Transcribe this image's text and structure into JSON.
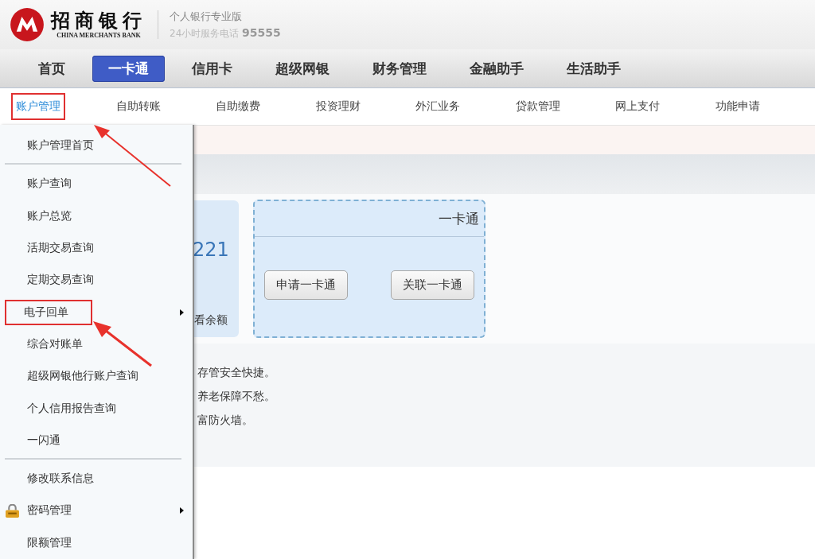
{
  "header": {
    "bank_name": "招商银行",
    "bank_name_en": "CHINA MERCHANTS BANK",
    "edition": "个人银行专业版",
    "hotline": "24小时服务电话 **95555**"
  },
  "main_nav": [
    {
      "label": "首页",
      "selected": false
    },
    {
      "label": "一卡通",
      "selected": true
    },
    {
      "label": "信用卡",
      "selected": false
    },
    {
      "label": "超级网银",
      "selected": false
    },
    {
      "label": "财务管理",
      "selected": false
    },
    {
      "label": "金融助手",
      "selected": false
    },
    {
      "label": "生活助手",
      "selected": false
    }
  ],
  "sub_nav": [
    {
      "label": "账户管理",
      "selected": true,
      "annotated": true
    },
    {
      "label": "自助转账",
      "selected": false,
      "annotated": false
    },
    {
      "label": "自助缴费",
      "selected": false,
      "annotated": false
    },
    {
      "label": "投资理财",
      "selected": false,
      "annotated": false
    },
    {
      "label": "外汇业务",
      "selected": false,
      "annotated": false
    },
    {
      "label": "贷款管理",
      "selected": false,
      "annotated": false
    },
    {
      "label": "网上支付",
      "selected": false,
      "annotated": false
    },
    {
      "label": "功能申请",
      "selected": false,
      "annotated": false
    }
  ],
  "dropdown_menu": [
    [
      {
        "label": "账户管理首页",
        "kind": "plain",
        "has_submenu": false,
        "annotated": false
      }
    ],
    [
      {
        "label": "账户查询",
        "kind": "plain",
        "has_submenu": false,
        "annotated": false
      },
      {
        "label": "账户总览",
        "kind": "plain",
        "has_submenu": false,
        "annotated": false
      },
      {
        "label": "活期交易查询",
        "kind": "plain",
        "has_submenu": false,
        "annotated": false
      },
      {
        "label": "定期交易查询",
        "kind": "plain",
        "has_submenu": false,
        "annotated": false
      },
      {
        "label": "电子回单",
        "kind": "plain",
        "has_submenu": true,
        "annotated": true
      },
      {
        "label": "综合对账单",
        "kind": "plain",
        "has_submenu": false,
        "annotated": false
      },
      {
        "label": "超级网银他行账户查询",
        "kind": "plain",
        "has_submenu": false,
        "annotated": false
      },
      {
        "label": "个人信用报告查询",
        "kind": "plain",
        "has_submenu": false,
        "annotated": false
      },
      {
        "label": "一闪通",
        "kind": "plain",
        "has_submenu": false,
        "annotated": false
      }
    ],
    [
      {
        "label": "修改联系信息",
        "kind": "plain",
        "has_submenu": false,
        "annotated": false
      },
      {
        "label": "密码管理",
        "kind": "locked",
        "has_submenu": true,
        "annotated": false
      },
      {
        "label": "限额管理",
        "kind": "plain",
        "has_submenu": false,
        "annotated": false
      }
    ]
  ],
  "account_card": {
    "number_fragment": "221",
    "link_fragment": "看余额"
  },
  "yikatong_card": {
    "title": "一卡通",
    "buttons": [
      "申请一卡通",
      "关联一卡通"
    ]
  },
  "promo_lines": [
    "存管安全快捷。",
    "养老保障不愁。",
    "富防火墙。"
  ]
}
